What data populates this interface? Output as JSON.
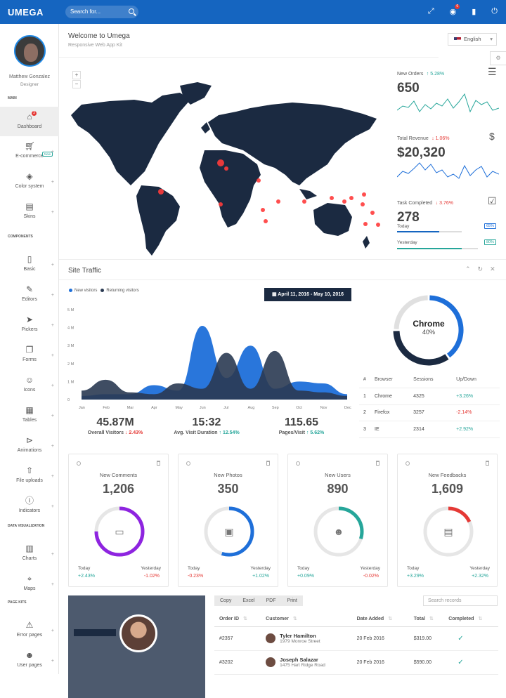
{
  "brand": {
    "logo": "UMEGA"
  },
  "search": {
    "placeholder": "Search for..."
  },
  "topbar": {
    "notif_count": "6"
  },
  "user": {
    "name": "Matthew Gonzalez",
    "role": "Designer"
  },
  "sidebar": {
    "sections": {
      "main": "MAIN",
      "components": "COMPONENTS",
      "dataviz": "DATA VISUALIZATION",
      "pagekits": "PAGE KITS"
    },
    "items": [
      {
        "label": "Dashboard",
        "icon": "home-icon",
        "badge": "3"
      },
      {
        "label": "E-commerce",
        "icon": "cart-icon",
        "tag": "New"
      },
      {
        "label": "Color system",
        "icon": "paint-bucket-icon"
      },
      {
        "label": "Skins",
        "icon": "skins-icon"
      },
      {
        "label": "Basic",
        "icon": "document-icon"
      },
      {
        "label": "Editors",
        "icon": "pencil-icon"
      },
      {
        "label": "Pickers",
        "icon": "cursor-icon"
      },
      {
        "label": "Forms",
        "icon": "forms-icon"
      },
      {
        "label": "Icons",
        "icon": "smiley-icon"
      },
      {
        "label": "Tables",
        "icon": "grid-icon"
      },
      {
        "label": "Animations",
        "icon": "play-forward-icon"
      },
      {
        "label": "File uploads",
        "icon": "upload-icon"
      },
      {
        "label": "Indicators",
        "icon": "info-icon"
      },
      {
        "label": "Charts",
        "icon": "bar-chart-icon"
      },
      {
        "label": "Maps",
        "icon": "map-pin-icon"
      },
      {
        "label": "Error pages",
        "icon": "warning-icon"
      },
      {
        "label": "User pages",
        "icon": "user-icon"
      }
    ]
  },
  "header": {
    "title": "Welcome to Umega",
    "subtitle": "Responsive Web App Kit",
    "language": "English"
  },
  "map": {
    "zoom_in": "+",
    "zoom_out": "−"
  },
  "stats": {
    "orders": {
      "label": "New Orders",
      "change": "5.28%",
      "value": "650"
    },
    "revenue": {
      "label": "Total Revenue",
      "change": "1.06%",
      "value": "$20,320"
    },
    "tasks": {
      "label": "Task Completed",
      "change": "3.76%",
      "value": "278"
    },
    "today": {
      "label": "Today",
      "pct": "65%",
      "fill": 0.65
    },
    "yesterday": {
      "label": "Yesterday",
      "pct": "80%",
      "fill": 0.8
    }
  },
  "traffic": {
    "title": "Site Traffic",
    "legend_new": "New visitors",
    "legend_returning": "Returning visitors",
    "date_range": "April 11, 2016 - May 10, 2016",
    "kpis": [
      {
        "value": "45.87M",
        "label": "Overall Visitors",
        "change": "2.43%",
        "dir": "down"
      },
      {
        "value": "15:32",
        "label": "Avg. Visit Duration",
        "change": "12.54%",
        "dir": "up"
      },
      {
        "value": "115.65",
        "label": "Pages/Visit",
        "change": "5.62%",
        "dir": "up"
      }
    ]
  },
  "chart_data": {
    "type": "area",
    "categories": [
      "Jan",
      "Feb",
      "Mar",
      "Apr",
      "May",
      "Jun",
      "Jul",
      "Aug",
      "Sep",
      "Oct",
      "Nov",
      "Dec"
    ],
    "ylabels": [
      "0",
      "1 M",
      "2 M",
      "3 M",
      "4 M",
      "5 M"
    ],
    "ylim": [
      0,
      5
    ],
    "series": [
      {
        "name": "New visitors",
        "color": "#1e6fd9",
        "values": [
          0.2,
          0.3,
          0.3,
          0.8,
          0.5,
          4.1,
          1.2,
          3.0,
          0.6,
          1.0,
          0.9,
          0.3
        ]
      },
      {
        "name": "Returning visitors",
        "color": "#2a3a52",
        "values": [
          0.5,
          1.1,
          0.4,
          0.3,
          0.9,
          0.6,
          2.6,
          0.6,
          2.7,
          0.5,
          0.4,
          0.2
        ]
      }
    ]
  },
  "browser": {
    "center_label": "Chrome",
    "center_pct": "40%",
    "slices": [
      {
        "name": "Chrome",
        "value": 40,
        "color": "#1e6fd9"
      },
      {
        "name": "Firefox",
        "value": 35,
        "color": "#1b2a41"
      },
      {
        "name": "IE",
        "value": 25,
        "color": "#e0e0e0"
      }
    ],
    "headers": [
      "#",
      "Browser",
      "Sessions",
      "Up/Down"
    ],
    "rows": [
      {
        "n": "1",
        "name": "Chrome",
        "sessions": "4325",
        "change": "+3.26%",
        "dir": "up"
      },
      {
        "n": "2",
        "name": "Firefox",
        "sessions": "3257",
        "change": "-2.14%",
        "dir": "down"
      },
      {
        "n": "3",
        "name": "IE",
        "sessions": "2314",
        "change": "+2.92%",
        "dir": "up"
      }
    ]
  },
  "cards": [
    {
      "title": "New Comments",
      "value": "1,206",
      "color": "#8e24e0",
      "fill": 0.75,
      "icon": "comment-icon",
      "today": "+2.43%",
      "today_dir": "up",
      "yesterday": "-1.02%",
      "yest_dir": "down"
    },
    {
      "title": "New Photos",
      "value": "350",
      "color": "#1e6fd9",
      "fill": 0.55,
      "icon": "image-icon",
      "today": "-0.23%",
      "today_dir": "down",
      "yesterday": "+1.02%",
      "yest_dir": "up"
    },
    {
      "title": "New Users",
      "value": "890",
      "color": "#26a69a",
      "fill": 0.3,
      "icon": "user-icon",
      "today": "+0.09%",
      "today_dir": "up",
      "yesterday": "-0.02%",
      "yest_dir": "down"
    },
    {
      "title": "New Feedbacks",
      "value": "1,609",
      "color": "#e53935",
      "fill": 0.18,
      "icon": "receipt-icon",
      "today": "+3.29%",
      "today_dir": "up",
      "yesterday": "+2.32%",
      "yest_dir": "up"
    }
  ],
  "card_labels": {
    "today": "Today",
    "yesterday": "Yesterday"
  },
  "orders": {
    "buttons": [
      "Copy",
      "Excel",
      "PDF",
      "Print"
    ],
    "search_placeholder": "Search records",
    "headers": [
      "Order ID",
      "Customer",
      "Date Added",
      "Total",
      "Completed"
    ],
    "rows": [
      {
        "id": "#2357",
        "name": "Tyler Hamilton",
        "address": "1979 Monroe Street",
        "date": "20 Feb 2016",
        "total": "$319.00"
      },
      {
        "id": "#3202",
        "name": "Joseph Salazar",
        "address": "1475 Hart Ridge Road",
        "date": "20 Feb 2016",
        "total": "$590.00"
      }
    ]
  }
}
